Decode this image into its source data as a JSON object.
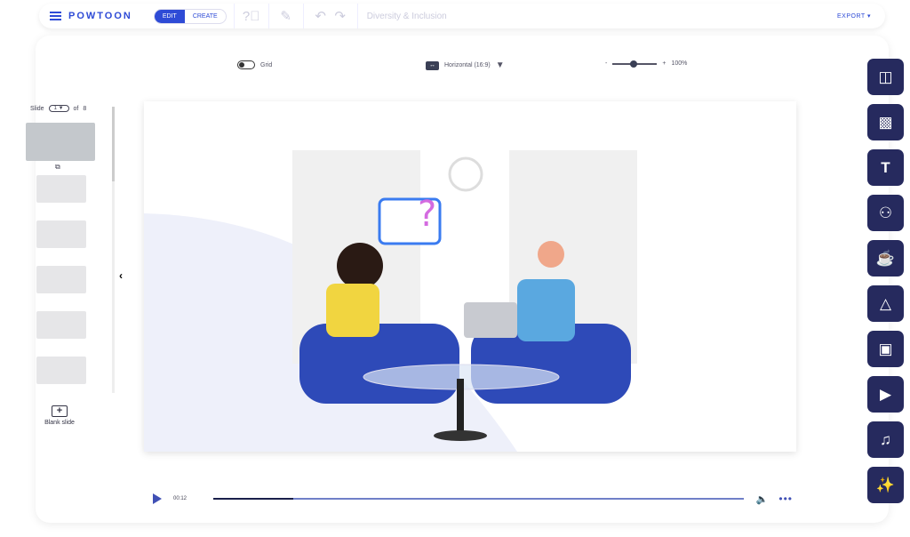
{
  "header": {
    "logo": "POWTOON",
    "mode_edit": "EDIT",
    "mode_create": "CREATE",
    "title": "Diversity & Inclusion",
    "export": "EXPORT"
  },
  "toolbar": {
    "grid_label": "Grid",
    "orientation": "Horizontal (16:9)",
    "zoom_minus": "-",
    "zoom_plus": "+",
    "zoom": "100%"
  },
  "slides": {
    "label": "Slide",
    "current": "1",
    "of": "of",
    "total": "8",
    "blank_label": "Blank slide",
    "thumb_count": 6
  },
  "player": {
    "time": "00:12",
    "progress_percent": 15
  },
  "tools": [
    "layout-icon",
    "background-icon",
    "text-icon",
    "characters-icon",
    "props-icon",
    "shapes-icon",
    "media-icon",
    "video-icon",
    "music-icon",
    "magic-icon"
  ],
  "colors": {
    "accent": "#2e4bd6",
    "tool_bg": "#262a5e"
  }
}
